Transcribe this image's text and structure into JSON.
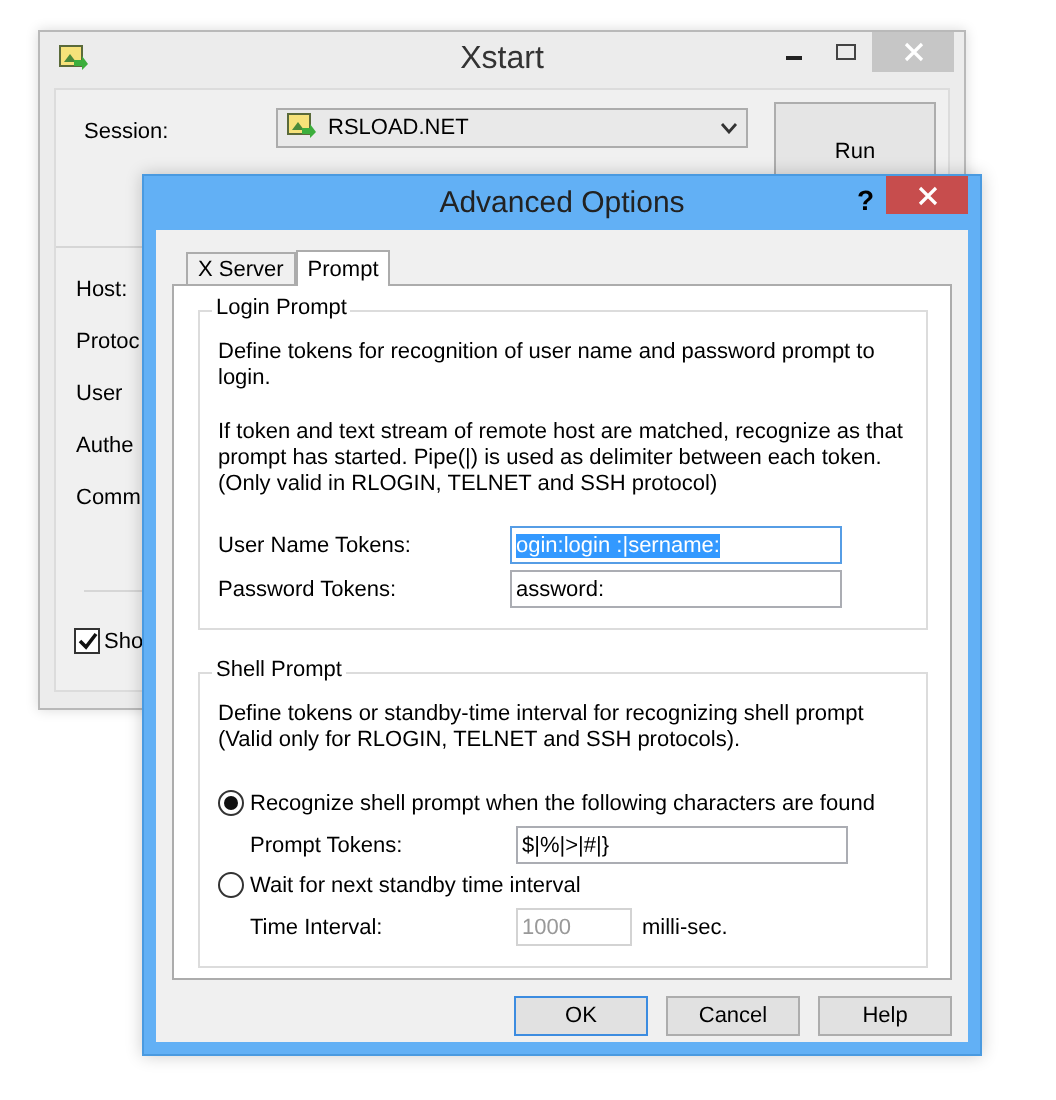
{
  "main_window": {
    "title": "Xstart",
    "session_label": "Session:",
    "session": "RSLOAD.NET",
    "run_button": "Run",
    "field_labels": [
      "Host:",
      "Protoc",
      "User",
      "Authe",
      "Comm"
    ],
    "show_checkbox": {
      "label": "Sho",
      "checked": true
    }
  },
  "dialog": {
    "title": "Advanced Options",
    "help": "?",
    "tabs": [
      {
        "label": "X Server",
        "selected": false
      },
      {
        "label": "Prompt",
        "selected": true
      }
    ],
    "login_group": {
      "title": "Login Prompt",
      "description": "Define tokens for recognition of user name and password prompt to login.",
      "note": "If token and text stream of remote host are matched, recognize as that prompt has started. Pipe(|) is used as delimiter between each token. (Only valid in RLOGIN, TELNET and SSH protocol)",
      "fields": [
        {
          "label": "User Name Tokens:",
          "value": "ogin:login :|sername:",
          "highlighted": true
        },
        {
          "label": "Password Tokens:",
          "value": "assword:",
          "highlighted": false
        }
      ]
    },
    "shell_group": {
      "title": "Shell Prompt",
      "description": "Define tokens or standby-time interval for recognizing shell prompt (Valid only for RLOGIN, TELNET and SSH protocols).",
      "options": [
        {
          "kind": "tokens",
          "label": "Recognize shell prompt when the following characters are found",
          "selected": true,
          "field_label": "Prompt Tokens:",
          "value": "$|%|>|#|}",
          "disabled": false
        },
        {
          "kind": "interval",
          "label": "Wait for next standby time interval",
          "selected": false,
          "field_label": "Time Interval:",
          "value": "1000",
          "unit": "milli-sec.",
          "disabled": true
        }
      ]
    },
    "buttons": [
      {
        "label": "OK",
        "default": true
      },
      {
        "label": "Cancel",
        "default": false
      },
      {
        "label": "Help",
        "default": false
      }
    ]
  }
}
